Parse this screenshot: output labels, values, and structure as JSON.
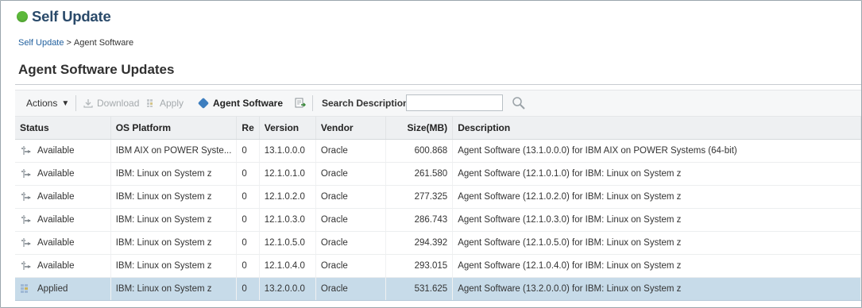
{
  "header": {
    "title": "Self Update",
    "status_color": "#5cb83a"
  },
  "breadcrumb": {
    "parent": "Self Update",
    "separator": ">",
    "current": "Agent Software"
  },
  "section": {
    "title": "Agent Software Updates"
  },
  "toolbar": {
    "actions_label": "Actions",
    "download_label": "Download",
    "apply_label": "Apply",
    "agent_software_label": "Agent Software",
    "search_label": "Search Description",
    "search_value": "",
    "icons": [
      "download-icon",
      "apply-icon",
      "agent-software-icon",
      "export-icon",
      "search-icon"
    ]
  },
  "table": {
    "columns": [
      "Status",
      "OS Platform",
      "Re",
      "Version",
      "Vendor",
      "Size(MB)",
      "Description"
    ],
    "rows": [
      {
        "status": "Available",
        "os": "IBM AIX on POWER Syste...",
        "re": "0",
        "version": "13.1.0.0.0",
        "vendor": "Oracle",
        "size": "600.868",
        "description": "Agent Software (13.1.0.0.0) for IBM AIX on POWER Systems (64-bit)"
      },
      {
        "status": "Available",
        "os": "IBM: Linux on System z",
        "re": "0",
        "version": "12.1.0.1.0",
        "vendor": "Oracle",
        "size": "261.580",
        "description": "Agent Software (12.1.0.1.0) for IBM: Linux on System z"
      },
      {
        "status": "Available",
        "os": "IBM: Linux on System z",
        "re": "0",
        "version": "12.1.0.2.0",
        "vendor": "Oracle",
        "size": "277.325",
        "description": "Agent Software (12.1.0.2.0) for IBM: Linux on System z"
      },
      {
        "status": "Available",
        "os": "IBM: Linux on System z",
        "re": "0",
        "version": "12.1.0.3.0",
        "vendor": "Oracle",
        "size": "286.743",
        "description": "Agent Software (12.1.0.3.0) for IBM: Linux on System z"
      },
      {
        "status": "Available",
        "os": "IBM: Linux on System z",
        "re": "0",
        "version": "12.1.0.5.0",
        "vendor": "Oracle",
        "size": "294.392",
        "description": "Agent Software (12.1.0.5.0) for IBM: Linux on System z"
      },
      {
        "status": "Available",
        "os": "IBM: Linux on System z",
        "re": "0",
        "version": "12.1.0.4.0",
        "vendor": "Oracle",
        "size": "293.015",
        "description": "Agent Software (12.1.0.4.0) for IBM: Linux on System z"
      },
      {
        "status": "Applied",
        "os": "IBM: Linux on System z",
        "re": "0",
        "version": "13.2.0.0.0",
        "vendor": "Oracle",
        "size": "531.625",
        "description": "Agent Software (13.2.0.0.0) for IBM: Linux on System z"
      }
    ]
  }
}
